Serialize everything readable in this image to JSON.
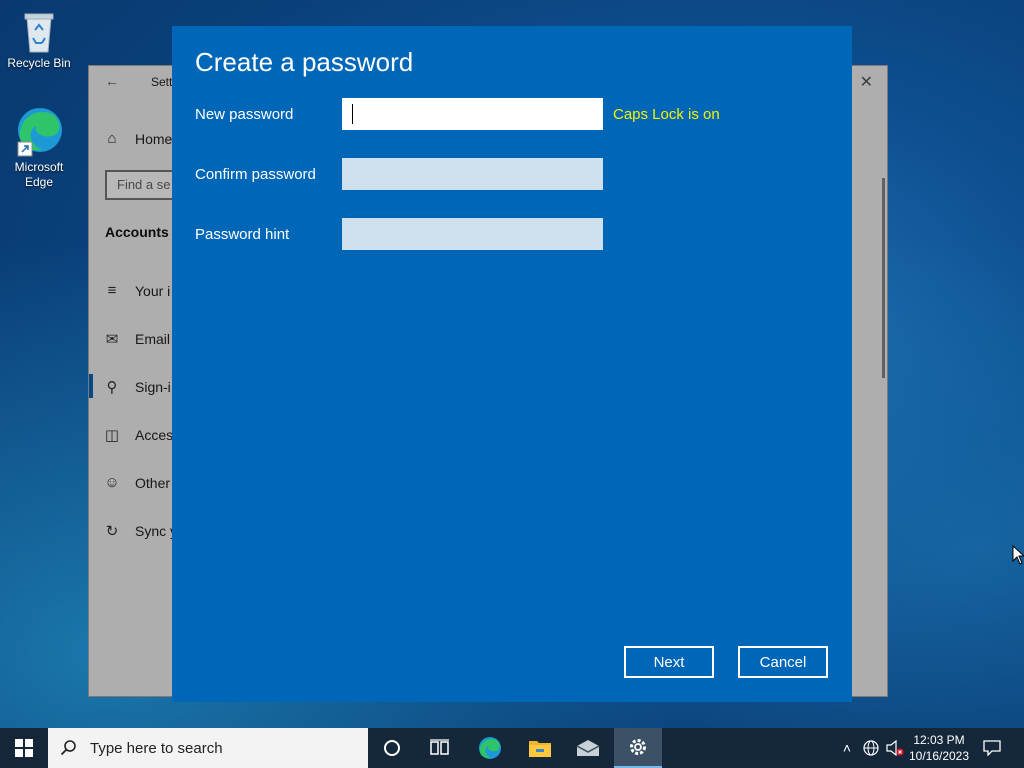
{
  "desktop": {
    "icons": [
      {
        "label": "Recycle Bin"
      },
      {
        "label": "Microsoft Edge"
      }
    ]
  },
  "settings": {
    "title": "Sett",
    "search_placeholder": "Find a se",
    "section": "Accounts",
    "nav": [
      {
        "label": "Home",
        "icon": "home-icon"
      },
      {
        "label": "Your i",
        "icon": "user-info-icon"
      },
      {
        "label": "Email",
        "icon": "mail-icon"
      },
      {
        "label": "Sign-i",
        "icon": "key-icon"
      },
      {
        "label": "Acces",
        "icon": "briefcase-icon"
      },
      {
        "label": "Other",
        "icon": "add-person-icon"
      },
      {
        "label": "Sync y",
        "icon": "sync-icon"
      }
    ]
  },
  "dialog": {
    "title": "Create a password",
    "fields": {
      "new_password": {
        "label": "New password",
        "value": ""
      },
      "confirm_password": {
        "label": "Confirm password",
        "value": ""
      },
      "password_hint": {
        "label": "Password hint",
        "value": ""
      }
    },
    "caps_lock_warning": "Caps Lock is on",
    "next_label": "Next",
    "cancel_label": "Cancel",
    "accent_color": "#0067b8",
    "warning_color": "#f5f500"
  },
  "taskbar": {
    "search_placeholder": "Type here to search",
    "time": "12:03 PM",
    "date": "10/16/2023"
  }
}
